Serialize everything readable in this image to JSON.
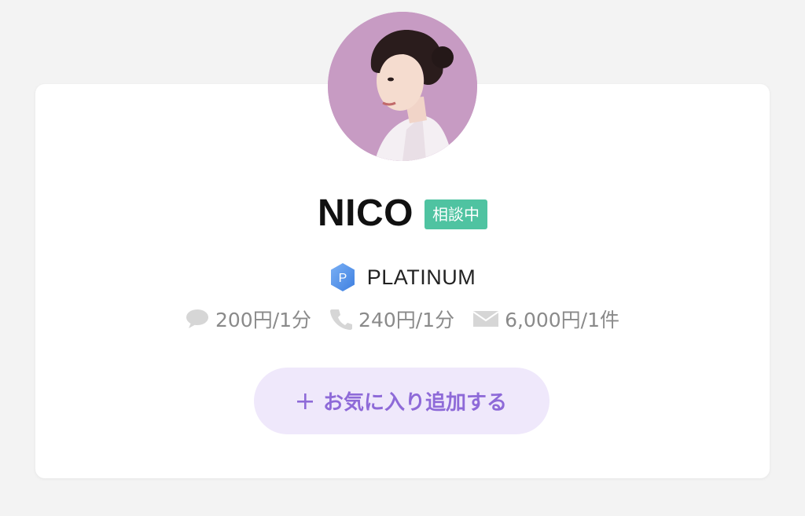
{
  "profile": {
    "name": "NICO",
    "status_badge": "相談中",
    "avatar": "portrait-photo"
  },
  "rank": {
    "icon_letter": "P",
    "label": "PLATINUM"
  },
  "prices": [
    {
      "icon": "chat-bubble-icon",
      "text": "200円/1分"
    },
    {
      "icon": "phone-icon",
      "text": "240円/1分"
    },
    {
      "icon": "mail-icon",
      "text": "6,000円/1件"
    }
  ],
  "favorite_button": {
    "icon": "plus-icon",
    "label": "お気に入り追加する"
  },
  "colors": {
    "status_badge": "#4fc3a1",
    "accent": "#8e6ad8",
    "button_bg": "#efe8fb",
    "avatar_bg": "#c79bc3",
    "rank_badge": "#4f8fe8"
  }
}
